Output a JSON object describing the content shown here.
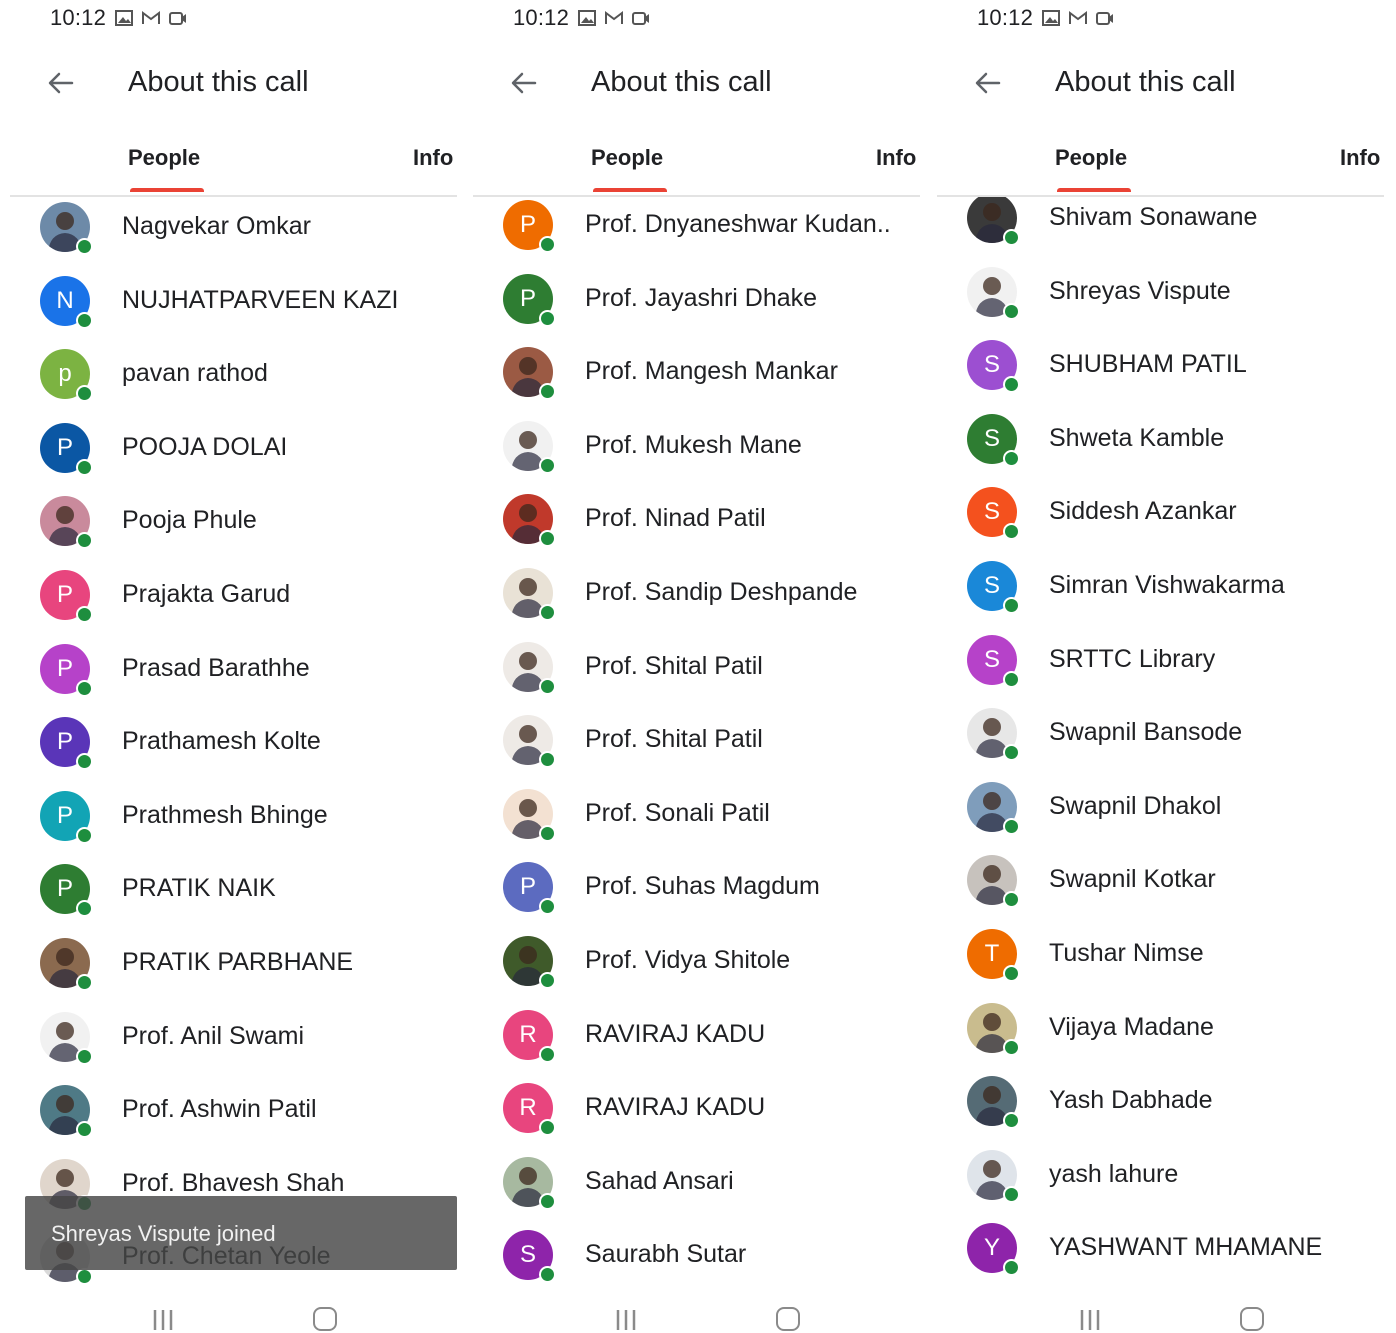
{
  "panels": [
    {
      "status_time": "10:12",
      "title": "About this call",
      "tabs": {
        "people": "People",
        "info": "Info"
      },
      "people": [
        {
          "name": "Nagvekar Omkar",
          "photo": true,
          "bg": "#6d8aa8"
        },
        {
          "name": "NUJHATPARVEEN KAZI",
          "initial": "N",
          "color": "#1a73e8"
        },
        {
          "name": "pavan rathod",
          "initial": "p",
          "color": "#7cb342"
        },
        {
          "name": "POOJA DOLAI",
          "initial": "P",
          "color": "#0b57a4"
        },
        {
          "name": "Pooja Phule",
          "photo": true,
          "bg": "#c98a9c"
        },
        {
          "name": "Prajakta Garud",
          "initial": "P",
          "color": "#e8457e"
        },
        {
          "name": "Prasad Barathhe",
          "initial": "P",
          "color": "#b642c9"
        },
        {
          "name": "Prathamesh Kolte",
          "initial": "P",
          "color": "#5a35b8"
        },
        {
          "name": "Prathmesh Bhinge",
          "initial": "P",
          "color": "#12a4b5"
        },
        {
          "name": "PRATIK NAIK",
          "initial": "P",
          "color": "#2e7d32"
        },
        {
          "name": "PRATIK PARBHANE",
          "photo": true,
          "bg": "#8b6a4f"
        },
        {
          "name": "Prof. Anil Swami",
          "photo": true,
          "bg": "#f1f1f1"
        },
        {
          "name": "Prof. Ashwin Patil",
          "photo": true,
          "bg": "#4f7a86"
        },
        {
          "name": "Prof. Bhavesh Shah",
          "photo": true,
          "bg": "#e0d6cc"
        },
        {
          "name": "Prof. Chetan Yeole",
          "photo": true,
          "bg": "#d9d9d9"
        }
      ],
      "toast": "Shreyas Vispute joined"
    },
    {
      "status_time": "10:12",
      "title": "About this call",
      "tabs": {
        "people": "People",
        "info": "Info"
      },
      "people": [
        {
          "name": "Prof. Dnyaneshwar Kudan..",
          "initial": "P",
          "color": "#ef6c00"
        },
        {
          "name": "Prof. Jayashri Dhake",
          "initial": "P",
          "color": "#2e7d32"
        },
        {
          "name": "Prof. Mangesh Mankar",
          "photo": true,
          "bg": "#9b5a44"
        },
        {
          "name": "Prof. Mukesh Mane",
          "photo": true,
          "bg": "#f1f1f1"
        },
        {
          "name": "Prof. Ninad Patil",
          "photo": true,
          "bg": "#c0392b"
        },
        {
          "name": "Prof. Sandip Deshpande",
          "photo": true,
          "bg": "#e9e2d6"
        },
        {
          "name": "Prof. Shital Patil",
          "photo": true,
          "bg": "#eeeae6"
        },
        {
          "name": "Prof. Shital Patil",
          "photo": true,
          "bg": "#eeeae6"
        },
        {
          "name": "Prof. Sonali Patil",
          "photo": true,
          "bg": "#f3e1d2"
        },
        {
          "name": "Prof. Suhas Magdum",
          "initial": "P",
          "color": "#5c6bc0"
        },
        {
          "name": "Prof. Vidya Shitole",
          "photo": true,
          "bg": "#3f5a2a"
        },
        {
          "name": "RAVIRAJ KADU",
          "initial": "R",
          "color": "#e8457e"
        },
        {
          "name": "RAVIRAJ KADU",
          "initial": "R",
          "color": "#e8457e"
        },
        {
          "name": "Sahad Ansari",
          "photo": true,
          "bg": "#a7b9a0"
        },
        {
          "name": "Saurabh Sutar",
          "initial": "S",
          "color": "#8e24aa"
        }
      ]
    },
    {
      "status_time": "10:12",
      "title": "About this call",
      "tabs": {
        "people": "People",
        "info": "Info"
      },
      "people": [
        {
          "name": "Shivam Sonawane",
          "photo": true,
          "bg": "#3a3a3a"
        },
        {
          "name": "Shreyas Vispute",
          "photo": true,
          "bg": "#f1f1f1"
        },
        {
          "name": "SHUBHAM PATIL",
          "initial": "S",
          "color": "#9c4fd1"
        },
        {
          "name": "Shweta Kamble",
          "initial": "S",
          "color": "#2e7d32"
        },
        {
          "name": "Siddesh Azankar",
          "initial": "S",
          "color": "#f4511e"
        },
        {
          "name": "Simran Vishwakarma",
          "initial": "S",
          "color": "#1a88d8"
        },
        {
          "name": "SRTTC Library",
          "initial": "S",
          "color": "#b642c9"
        },
        {
          "name": "Swapnil Bansode",
          "photo": true,
          "bg": "#e7e7e7"
        },
        {
          "name": "Swapnil Dhakol",
          "photo": true,
          "bg": "#7f9dbb"
        },
        {
          "name": "Swapnil Kotkar",
          "photo": true,
          "bg": "#c7c2bd"
        },
        {
          "name": "Tushar Nimse",
          "initial": "T",
          "color": "#ef6c00"
        },
        {
          "name": "Vijaya Madane",
          "photo": true,
          "bg": "#c9bc8e"
        },
        {
          "name": "Yash Dabhade",
          "photo": true,
          "bg": "#556b75"
        },
        {
          "name": "yash lahure",
          "photo": true,
          "bg": "#dfe4ea"
        },
        {
          "name": "YASHWANT MHAMANE",
          "initial": "Y",
          "color": "#8e24aa"
        }
      ]
    }
  ]
}
